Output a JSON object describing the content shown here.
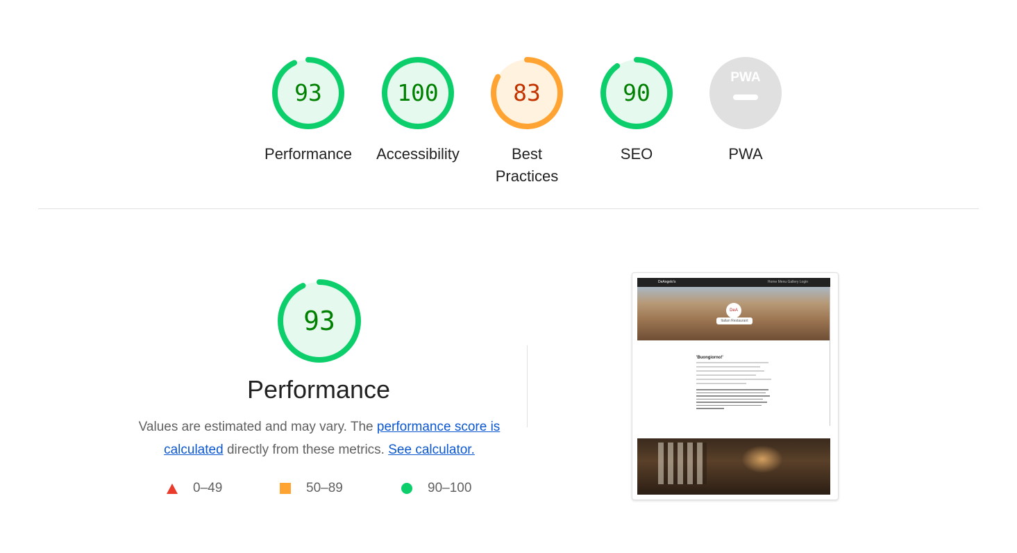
{
  "categories": [
    {
      "id": "performance",
      "score": "93",
      "label": "Performance",
      "value": 0.93,
      "rating": "pass"
    },
    {
      "id": "accessibility",
      "score": "100",
      "label": "Accessibility",
      "value": 1.0,
      "rating": "pass"
    },
    {
      "id": "best-practices",
      "score": "83",
      "label_line1": "Best",
      "label_line2": "Practices",
      "value": 0.83,
      "rating": "average"
    },
    {
      "id": "seo",
      "score": "90",
      "label": "SEO",
      "value": 0.9,
      "rating": "pass"
    },
    {
      "id": "pwa",
      "label": "PWA",
      "badge_text": "PWA"
    }
  ],
  "performance_section": {
    "score": "93",
    "value": 0.93,
    "title": "Performance",
    "desc_prefix": "Values are estimated and may vary. The ",
    "desc_link": "performance score is calculated",
    "desc_middle": " directly from these metrics. ",
    "desc_calc_link": "See calculator."
  },
  "legend": [
    {
      "range": "0–49",
      "shape": "triangle",
      "color": "#eb3b2c"
    },
    {
      "range": "50–89",
      "shape": "square",
      "color": "#ffa433"
    },
    {
      "range": "90–100",
      "shape": "circle",
      "color": "#0cce6b"
    }
  ],
  "screenshot": {
    "nav_brand": "DeAngelo's",
    "nav_links": "Home  Menu  Gallery  Login",
    "logo_text": "DeA",
    "sign_text": "Italian Restaurant",
    "heading": "'Buongiorno!'"
  },
  "colors": {
    "pass": "#0cce6b",
    "pass_fill": "#e5f9ee",
    "average": "#ffa433",
    "average_fill": "#fff3e0",
    "pwa_fill": "#e0e0e0"
  }
}
